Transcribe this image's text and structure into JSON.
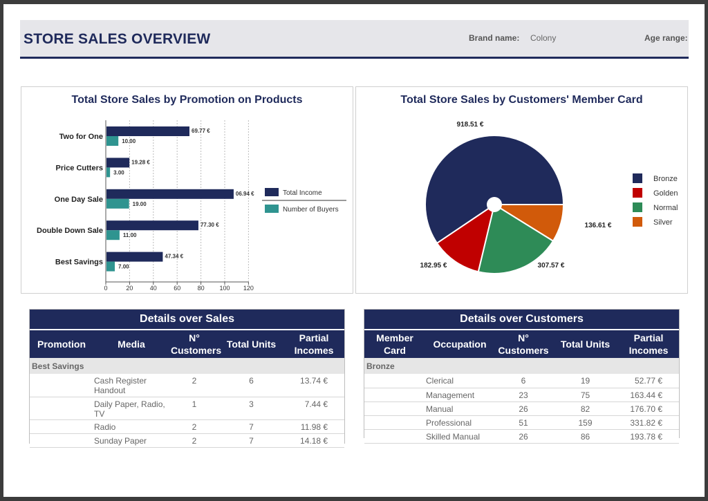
{
  "header": {
    "title": "STORE SALES OVERVIEW",
    "brand_label": "Brand name:",
    "brand_value": "Colony",
    "age_label": "Age range:"
  },
  "bar_chart": {
    "title": "Total Store Sales by Promotion on Products",
    "legend": [
      "Total Income",
      "Number of Buyers"
    ]
  },
  "pie_chart": {
    "title": "Total Store Sales by Customers' Member Card",
    "legend": [
      "Bronze",
      "Golden",
      "Normal",
      "Silver"
    ]
  },
  "chart_data": [
    {
      "type": "bar",
      "orientation": "horizontal",
      "title": "Total Store Sales by Promotion on Products",
      "categories": [
        "Two for One",
        "Price Cutters",
        "One Day Sale",
        "Double Down Sale",
        "Best Savings"
      ],
      "series": [
        {
          "name": "Total Income",
          "color": "#1f2a5b",
          "values": [
            69.77,
            19.28,
            106.94,
            77.3,
            47.34
          ],
          "labels": [
            "69.77 €",
            "19.28 €",
            "06.94 €",
            "77.30 €",
            "47.34 €"
          ]
        },
        {
          "name": "Number of Buyers",
          "color": "#2f9490",
          "values": [
            10,
            3,
            19,
            11,
            7
          ],
          "labels": [
            "10.00",
            "3.00",
            "19.00",
            "11.00",
            "7.00"
          ]
        }
      ],
      "x_ticks": [
        "0",
        "20",
        "40",
        "60",
        "80",
        "100",
        "120"
      ],
      "xlim": [
        0,
        120
      ],
      "grid": true,
      "legend_position": "right"
    },
    {
      "type": "pie",
      "title": "Total Store Sales by Customers' Member Card",
      "slices": [
        {
          "name": "Bronze",
          "value": 918.51,
          "label": "918.51 €",
          "color": "#1f2a5b"
        },
        {
          "name": "Silver",
          "value": 136.61,
          "label": "136.61 €",
          "color": "#d15a0a"
        },
        {
          "name": "Normal",
          "value": 307.57,
          "label": "307.57 €",
          "color": "#2e8b57"
        },
        {
          "name": "Golden",
          "value": 182.95,
          "label": "182.95 €",
          "color": "#c00000"
        }
      ],
      "legend_position": "right"
    }
  ],
  "sales_table": {
    "title": "Details over Sales",
    "headers": [
      "Promotion",
      "Media",
      "N° Customers",
      "Total Units",
      "Partial Incomes"
    ],
    "group": "Best Savings",
    "rows": [
      [
        "",
        "Cash Register Handout",
        "2",
        "6",
        "13.74 €"
      ],
      [
        "",
        "Daily Paper, Radio, TV",
        "1",
        "3",
        "7.44 €"
      ],
      [
        "",
        "Radio",
        "2",
        "7",
        "11.98 €"
      ],
      [
        "",
        "Sunday Paper",
        "2",
        "7",
        "14.18 €"
      ]
    ]
  },
  "customers_table": {
    "title": "Details over Customers",
    "headers": [
      "Member Card",
      "Occupation",
      "N° Customers",
      "Total Units",
      "Partial Incomes"
    ],
    "group": "Bronze",
    "rows": [
      [
        "",
        "Clerical",
        "6",
        "19",
        "52.77 €"
      ],
      [
        "",
        "Management",
        "23",
        "75",
        "163.44 €"
      ],
      [
        "",
        "Manual",
        "26",
        "82",
        "176.70 €"
      ],
      [
        "",
        "Professional",
        "51",
        "159",
        "331.82 €"
      ],
      [
        "",
        "Skilled Manual",
        "26",
        "86",
        "193.78 €"
      ]
    ]
  }
}
